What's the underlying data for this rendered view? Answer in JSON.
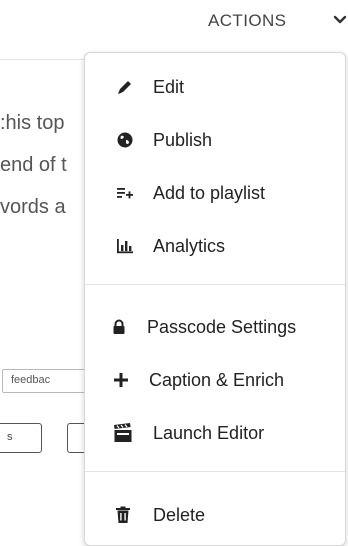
{
  "header": {
    "actions_label": "ACTIONS",
    "chevron_icon": "chevron-down-icon"
  },
  "background": {
    "lines": [
      ":his top",
      "end of t",
      "vords a"
    ],
    "tag_text": "feedbac",
    "button_text": "s"
  },
  "menu": {
    "items": [
      {
        "label": "Edit",
        "icon": "pencil-icon"
      },
      {
        "label": "Publish",
        "icon": "globe-icon"
      },
      {
        "label": "Add to playlist",
        "icon": "playlist-add-icon"
      },
      {
        "label": "Analytics",
        "icon": "bar-chart-icon"
      },
      {
        "label": "Passcode Settings",
        "icon": "lock-icon"
      },
      {
        "label": "Caption & Enrich",
        "icon": "plus-icon"
      },
      {
        "label": "Launch Editor",
        "icon": "clapperboard-icon"
      },
      {
        "label": "Delete",
        "icon": "trash-icon"
      }
    ]
  },
  "colors": {
    "text": "#222222",
    "muted": "#555555",
    "border": "#d8d8d8"
  }
}
